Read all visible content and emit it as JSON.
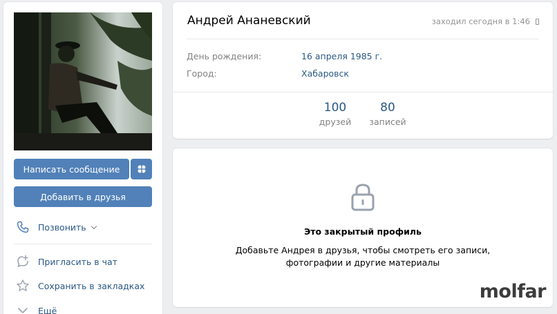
{
  "profile": {
    "name": "Андрей Ананевский",
    "online_status": "заходил сегодня в 1:46",
    "birthday_label": "День рождения:",
    "birthday_value": "16 апреля 1985 г.",
    "city_label": "Город:",
    "city_value": "Хабаровск"
  },
  "counters": [
    {
      "value": "100",
      "label": "друзей"
    },
    {
      "value": "80",
      "label": "записей"
    }
  ],
  "actions": {
    "message_button": "Написать сообщение",
    "add_friend_button": "Добавить в друзья",
    "call": "Позвонить",
    "invite_chat": "Пригласить в чат",
    "save_bookmarks": "Сохранить в закладках",
    "more": "Ещё"
  },
  "closed_profile": {
    "title": "Это закрытый профиль",
    "text_line1": "Добавьте Андрея в друзья, чтобы смотреть его записи,",
    "text_line2": "фотографии и другие материалы"
  },
  "watermark": "molfar",
  "colors": {
    "accent": "#5181b8",
    "link": "#2a5885",
    "muted": "#828282",
    "background": "#edeef0"
  },
  "icons": [
    "gift-icon",
    "phone-icon",
    "chat-add-icon",
    "star-icon",
    "chevron-down-icon",
    "lock-icon",
    "mobile-icon"
  ]
}
